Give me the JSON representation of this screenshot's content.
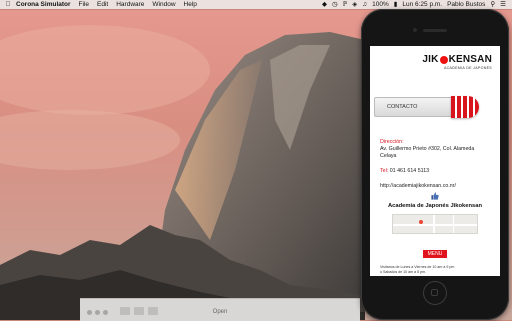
{
  "menubar": {
    "app_name": "Corona Simulator",
    "items": [
      "File",
      "Edit",
      "Hardware",
      "Window",
      "Help"
    ],
    "battery": "100%",
    "clock": "Lun 6:25 p.m.",
    "user": "Pablo Bustos"
  },
  "bottom_window": {
    "title": "Open"
  },
  "app": {
    "logo_text_left": "JIK",
    "logo_text_right": "KENSAN",
    "logo_sub": "ACADEMIA DE JAPONÉS",
    "contact_label": "CONTACTO",
    "address_label": "Dirección:",
    "address_line1": "Av. Guillermo Prieto #302, Col. Alameda",
    "address_line2": "Celaya",
    "tel_label": "Tel:",
    "tel_value": "01 461 614 5113",
    "website": "http://academiajikokensan.co.nr/",
    "academy_title": "Academia de Japonés Jikokensan",
    "menu_label": "MENU",
    "hours_line1": "Visitanos de Lunes a Viernes de 10 am a 9 pm",
    "hours_line2": "o Sabados de 10 am a 5 pm."
  },
  "colors": {
    "accent_red": "#d8141d",
    "phone_body": "#151515"
  },
  "icons": [
    "apple-icon",
    "like-icon",
    "map-pin-icon",
    "wifi-icon",
    "battery-icon",
    "volume-icon",
    "search-icon"
  ]
}
